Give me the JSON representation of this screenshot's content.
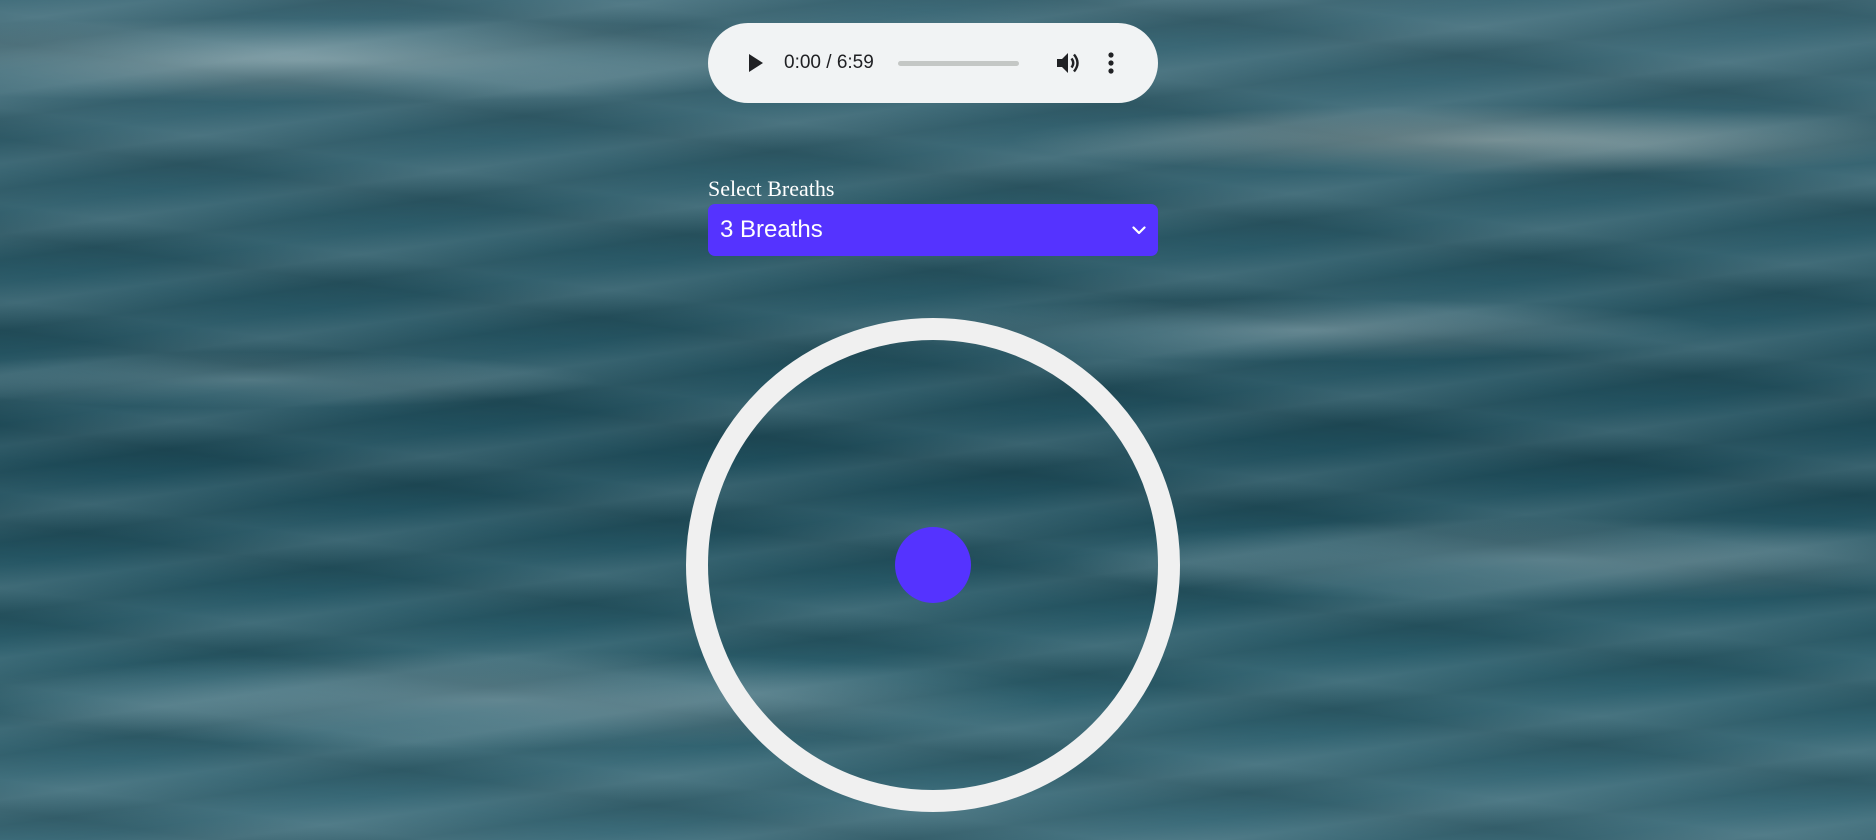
{
  "audio_player": {
    "time_display": "0:00 / 6:59",
    "progress": 0,
    "icons": {
      "play": "play-icon",
      "volume": "volume-icon",
      "more": "more-vertical-icon"
    }
  },
  "breath_selector": {
    "label": "Select Breaths",
    "selected": "3 Breaths",
    "icon": "chevron-down-icon"
  },
  "colors": {
    "accent": "#5533ff",
    "ring": "#f0f0f0",
    "player_bg": "#f1f3f4"
  }
}
